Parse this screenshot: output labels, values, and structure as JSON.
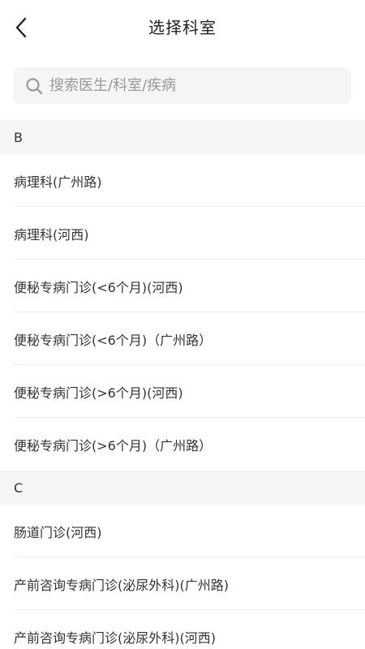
{
  "header": {
    "title": "选择科室",
    "back_icon": "chevron-left-icon"
  },
  "search": {
    "placeholder": "搜索医生/科室/疾病",
    "icon": "search-icon"
  },
  "sections": [
    {
      "letter": "B",
      "items": [
        "病理科(广州路)",
        "病理科(河西)",
        "便秘专病门诊(<6个月)(河西)",
        "便秘专病门诊(<6个月)（广州路）",
        "便秘专病门诊(>6个月)(河西)",
        "便秘专病门诊(>6个月)（广州路）"
      ]
    },
    {
      "letter": "C",
      "items": [
        "肠道门诊(河西)",
        "产前咨询专病门诊(泌尿外科)(广州路)",
        "产前咨询专病门诊(泌尿外科)(河西)"
      ]
    }
  ],
  "colors": {
    "background": "#ffffff",
    "section_bg": "#f5f5f5",
    "text": "#333333",
    "placeholder": "#999999",
    "divider": "#eeeeee"
  }
}
